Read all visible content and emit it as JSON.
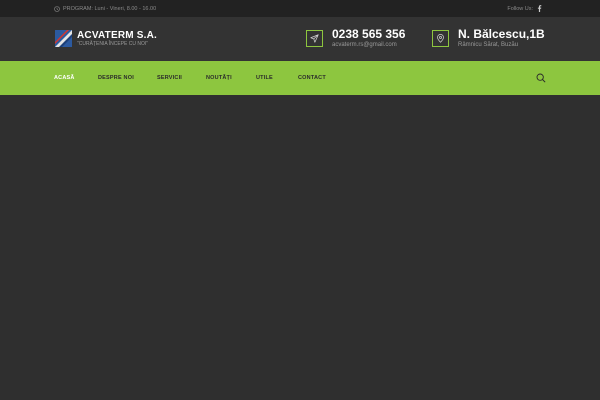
{
  "topbar": {
    "program": "PROGRAM: Luni - Vineri, 8.00 - 16.00",
    "follow": "Follow Us:"
  },
  "header": {
    "brand": "ACVATERM S.A.",
    "slogan": "\"CURĂȚENIA ÎNCEPE CU NOI\"",
    "phone": "0238 565 356",
    "email": "acvaterm.rs@gmail.com",
    "address_main": "N. Bălcescu,1B",
    "address_sub": "Râmnicu Sărat, Buzău"
  },
  "nav": {
    "items": [
      "ACASĂ",
      "DESPRE NOI",
      "SERVICII",
      "NOUTĂȚI",
      "UTILE",
      "CONTACT"
    ],
    "active_index": 0
  },
  "colors": {
    "accent": "#8dc63f",
    "topbar_bg": "#222222",
    "header_bg": "#333333",
    "body_bg": "#2f2f2f"
  },
  "icons": [
    "clock-icon",
    "facebook-icon",
    "logo-icon",
    "send-icon",
    "map-pin-icon",
    "search-icon"
  ]
}
